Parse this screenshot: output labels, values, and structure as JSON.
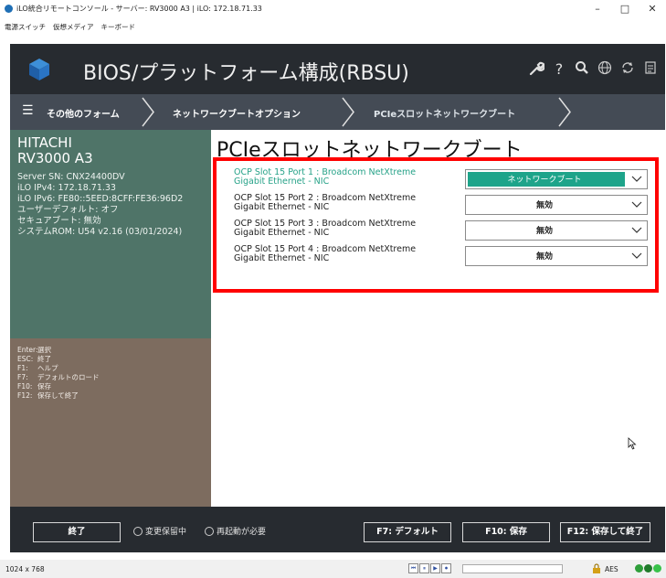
{
  "window": {
    "title": "iLO統合リモートコンソール - サーバー: RV3000 A3 | iLO: 172.18.71.33",
    "minimize": "–",
    "maximize": "□",
    "close": "✕"
  },
  "menubar": [
    "電源スイッチ",
    "仮想メディア",
    "キーボード"
  ],
  "header": {
    "title": "BIOS/プラットフォーム構成(RBSU)",
    "icons": [
      "wrench-icon",
      "help-icon",
      "search-icon",
      "globe-icon",
      "refresh-icon",
      "document-icon"
    ],
    "help_glyph": "?"
  },
  "breadcrumb": {
    "menu_glyph": "☰",
    "items": [
      "その他のフォーム",
      "ネットワークブートオプション",
      "PCIeスロットネットワークブート"
    ]
  },
  "system": {
    "vendor": "HITACHI",
    "model": "RV3000 A3",
    "lines": [
      "Server SN: CNX24400DV",
      "iLO IPv4: 172.18.71.33",
      "iLO IPv6: FE80::5EED:8CFF:FE36:96D2",
      "ユーザーデフォルト: オフ",
      "セキュアブート: 無効",
      "システムROM: U54 v2.16 (03/01/2024)"
    ]
  },
  "keys": [
    {
      "key": "Enter:",
      "desc": "選択"
    },
    {
      "key": "ESC:",
      "desc": "終了"
    },
    {
      "key": "F1:",
      "desc": "ヘルプ"
    },
    {
      "key": "F7:",
      "desc": "デフォルトのロード"
    },
    {
      "key": "F10:",
      "desc": "保存"
    },
    {
      "key": "F12:",
      "desc": "保存して終了"
    }
  ],
  "main": {
    "title": "PCIeスロットネットワークブート",
    "rows": [
      {
        "label": "OCP Slot 15 Port 1 : Broadcom NetXtreme Gigabit Ethernet - NIC",
        "value": "ネットワークブート",
        "active": true
      },
      {
        "label": "OCP Slot 15 Port 2 : Broadcom NetXtreme Gigabit Ethernet - NIC",
        "value": "無効",
        "active": false
      },
      {
        "label": "OCP Slot 15 Port 3 : Broadcom NetXtreme Gigabit Ethernet - NIC",
        "value": "無効",
        "active": false
      },
      {
        "label": "OCP Slot 15 Port 4 : Broadcom NetXtreme Gigabit Ethernet - NIC",
        "value": "無効",
        "active": false
      }
    ]
  },
  "footer": {
    "exit": "終了",
    "pending": "変更保留中",
    "reboot": "再起動が必要",
    "f7": "F7: デフォルト",
    "f10": "F10: 保存",
    "f12": "F12: 保存して終了"
  },
  "status": {
    "resolution": "1024 x 768",
    "encryption": "AES",
    "media_buttons": [
      "⏮",
      "⏸",
      "▶",
      "⏺"
    ]
  },
  "colors": {
    "accent": "#1ea48a",
    "highlight_border": "#ff0000",
    "header_bg": "#272b30",
    "system_panel": "#4f7468",
    "key_panel": "#7d6c5f"
  }
}
